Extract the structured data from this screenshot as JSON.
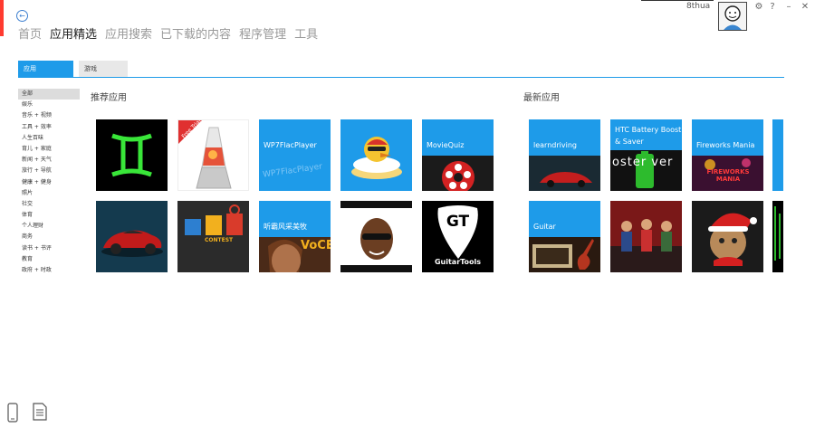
{
  "colors": {
    "accent": "#1e9be9",
    "brand_bar": "#ff3b30"
  },
  "header": {
    "username": "8thua",
    "window_buttons": [
      "gear-icon",
      "help-icon",
      "minimize-icon",
      "close-icon"
    ]
  },
  "nav": {
    "items": [
      "首页",
      "应用精选",
      "应用搜索",
      "已下载的内容",
      "程序管理",
      "工具"
    ],
    "active_index": 1
  },
  "tabs": [
    "应用",
    "游戏"
  ],
  "categories": [
    "全部",
    "娱乐",
    "音乐 + 视频",
    "工具 + 效率",
    "人生百味",
    "育儿 + 家庭",
    "新闻 + 天气",
    "旅行 + 导航",
    "健康 + 健身",
    "照片",
    "社交",
    "体育",
    "个人理财",
    "商务",
    "读书 + 书评",
    "教育",
    "政府 + 时政"
  ],
  "sections": {
    "recommended": {
      "title": "推荐应用",
      "tiles": [
        {
          "kind": "gemini-icon"
        },
        {
          "kind": "lava-lamp-icon",
          "ribbon": "Free Trial"
        },
        {
          "kind": "label",
          "label": "WP7FlacPlayer",
          "watermark": "WP7FlacPlayer"
        },
        {
          "kind": "duck-icon"
        },
        {
          "kind": "label",
          "label": "MovieQuiz"
        },
        {
          "kind": "sports-car-icon"
        },
        {
          "kind": "contest-icon",
          "caption": "CONTEST"
        },
        {
          "kind": "label",
          "label": "听霸风采美牧",
          "watermark": "VoCE"
        },
        {
          "kind": "photo-person-icon"
        },
        {
          "kind": "guitar-pick-icon",
          "big": "GT",
          "caption": "GuitarTools"
        }
      ]
    },
    "latest": {
      "title": "最新应用",
      "tiles": [
        {
          "kind": "label",
          "label": "learndriving"
        },
        {
          "kind": "label",
          "label": "HTC Battery Boost & Saver",
          "watermark": "oster ver"
        },
        {
          "kind": "label",
          "label": "Fireworks Mania",
          "watermark": "FIREWORKS MANIA"
        },
        {
          "kind": "blank-blue"
        },
        {
          "kind": "label",
          "label": "Guitar"
        },
        {
          "kind": "band-photo-icon"
        },
        {
          "kind": "santa-cat-icon"
        },
        {
          "kind": "matrix-icon"
        }
      ]
    }
  },
  "bottom_icons": [
    "phone-icon",
    "document-icon"
  ]
}
